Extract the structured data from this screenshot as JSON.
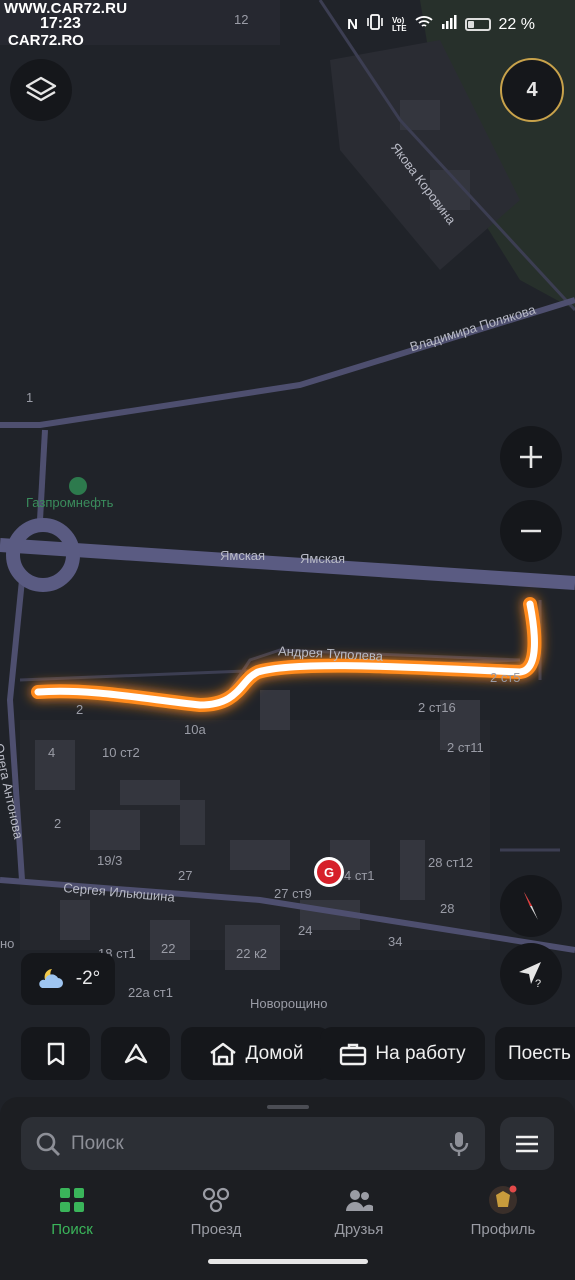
{
  "status_bar": {
    "watermark_top": "WWW.CAR72.RU",
    "watermark_bottom": "CAR72.RO",
    "time": "17:23",
    "battery_percent": "22 %"
  },
  "map": {
    "route_badge": "4",
    "streets": {
      "yakova": "Якова Коровина",
      "polyakova": "Владимира Полякова",
      "yamskaya_1": "Ямская",
      "yamskaya_2": "Ямская",
      "tupoleva": "Андрея Туполева",
      "antonova": "Олега Антонова",
      "ilyushina": "Сергея Ильюшина"
    },
    "poi": {
      "gazpromneft": "Газпромнефть",
      "novoroshchino": "Новорощино",
      "edge_partial": "но"
    },
    "house_numbers": {
      "n12": "12",
      "n1": "1",
      "n2a": "2",
      "n10a": "10а",
      "n4": "4",
      "n10st2": "10 ст2",
      "n2b": "2",
      "n19_3": "19/3",
      "n27": "27",
      "n27st9": "27 ст9",
      "n4st1": "4 ст1",
      "n28st12": "28 ст12",
      "n28": "28",
      "n24": "24",
      "n34": "34",
      "n18st1": "18 ст1",
      "n22": "22",
      "n22k2": "22 к2",
      "n22ast1": "22а ст1",
      "n2st16": "2 ст16",
      "n2st11": "2 ст11",
      "n2st5": "2 ст5"
    },
    "weather": "-2°"
  },
  "chips": {
    "home": "Домой",
    "work": "На работу",
    "eat": "Поесть"
  },
  "search": {
    "placeholder": "Поиск"
  },
  "tabs": {
    "search": "Поиск",
    "drive": "Проезд",
    "friends": "Друзья",
    "profile": "Профиль"
  },
  "colors": {
    "accent_green": "#3ab55a",
    "route_glow": "#ff8a1c",
    "badge_ring": "#c8a24b",
    "road": "#5a5b82"
  }
}
